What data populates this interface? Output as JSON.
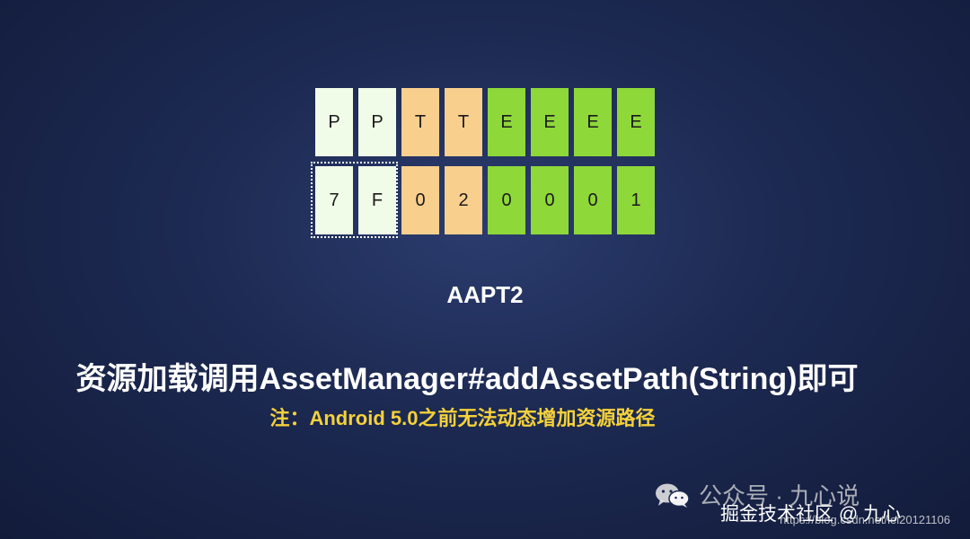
{
  "top_row": [
    "P",
    "P",
    "T",
    "T",
    "E",
    "E",
    "E",
    "E"
  ],
  "bottom_row": [
    "7",
    "F",
    "0",
    "2",
    "0",
    "0",
    "0",
    "1"
  ],
  "caption": "AAPT2",
  "main_text": "资源加载调用AssetManager#addAssetPath(String)即可",
  "note_text": "注：Android 5.0之前无法动态增加资源路径",
  "watermark": {
    "line1": "公众号 · 九心说",
    "line2": "掘金技术社区 @ 九心",
    "url": "https://blog.csdn.net/lei20121106"
  },
  "colors": {
    "package_cell": "#f1fce8",
    "type_cell": "#f9cf8e",
    "entry_cell": "#8ed83a",
    "note_text": "#f5d13a"
  }
}
